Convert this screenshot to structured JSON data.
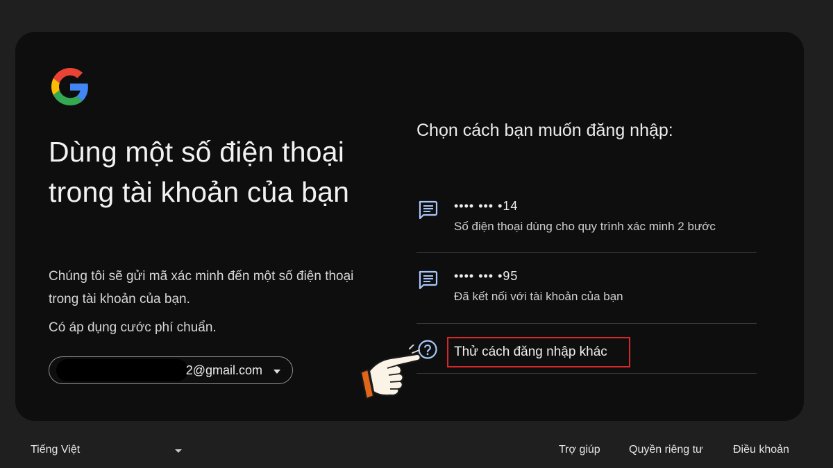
{
  "headline": "Dùng một số điện thoại trong tài khoản của bạn",
  "description": "Chúng tôi sẽ gửi mã xác minh đến một số điện thoại trong tài khoản của bạn.",
  "fee_note": "Có áp dụng cước phí chuẩn.",
  "account": {
    "email_suffix": "2@gmail.com"
  },
  "options_title": "Chọn cách bạn muốn đăng nhập:",
  "options": [
    {
      "icon": "sms-icon",
      "primary": "•••• ••• •14",
      "secondary": "Số điện thoại dùng cho quy trình xác minh 2 bước"
    },
    {
      "icon": "sms-icon",
      "primary": "•••• ••• •95",
      "secondary": "Đã kết nối với tài khoản của bạn"
    }
  ],
  "other_option": {
    "icon": "help-icon",
    "label": "Thử cách đăng nhập khác",
    "highlight_color": "#d9262b"
  },
  "footer": {
    "language": "Tiếng Việt",
    "help": "Trợ giúp",
    "privacy": "Quyền riêng tư",
    "terms": "Điều khoản"
  },
  "colors": {
    "background": "#1f1f1f",
    "card": "#0e0e0e",
    "accent": "#a8c7fa",
    "google_blue": "#4285F4",
    "google_red": "#EA4335",
    "google_yellow": "#FBBC05",
    "google_green": "#34A853"
  }
}
